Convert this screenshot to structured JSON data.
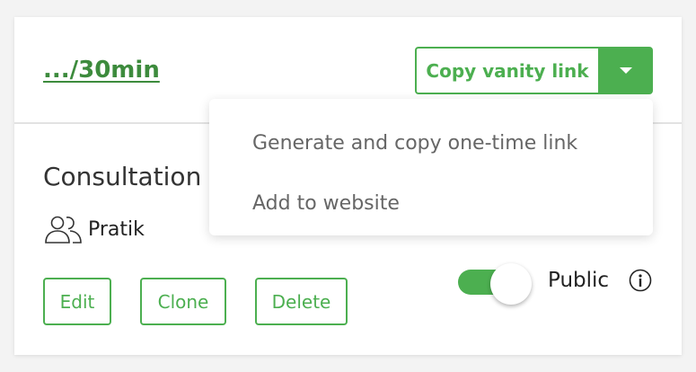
{
  "header": {
    "vanity_path": ".../30min",
    "copy_button_label": "Copy vanity link",
    "dropdown_toggle_icon": "caret-down-icon"
  },
  "dropdown": {
    "items": [
      {
        "label": "Generate and copy one-time link"
      },
      {
        "label": "Add to website"
      }
    ]
  },
  "event": {
    "title": "Consultation",
    "owner_icon": "users-icon",
    "owner": "Pratik"
  },
  "actions": {
    "edit_label": "Edit",
    "clone_label": "Clone",
    "delete_label": "Delete"
  },
  "visibility": {
    "toggle_on": true,
    "label": "Public",
    "info_icon": "info-icon"
  },
  "colors": {
    "accent": "#4caf50",
    "link": "#3d8b3d",
    "background": "#f3f3f3"
  }
}
